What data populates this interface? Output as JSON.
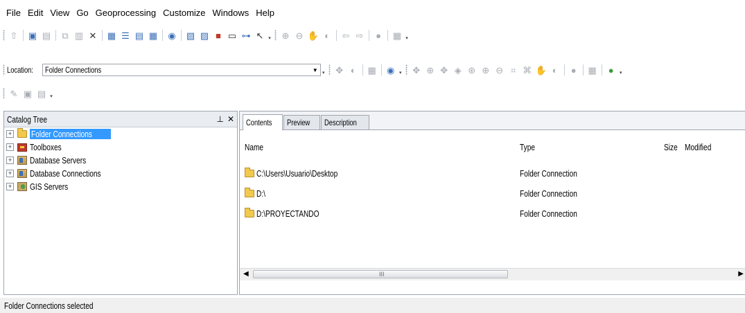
{
  "menu": [
    "File",
    "Edit",
    "View",
    "Go",
    "Geoprocessing",
    "Customize",
    "Windows",
    "Help"
  ],
  "location": {
    "label": "Location:",
    "value": "Folder Connections"
  },
  "catalog_tree": {
    "title": "Catalog Tree",
    "pin_icon": "pin-icon",
    "close_icon": "close-icon",
    "items": [
      {
        "label": "Folder Connections",
        "icon": "folder-connections-icon",
        "selected": true
      },
      {
        "label": "Toolboxes",
        "icon": "toolbox-icon",
        "selected": false
      },
      {
        "label": "Database Servers",
        "icon": "database-server-icon",
        "selected": false
      },
      {
        "label": "Database Connections",
        "icon": "database-connection-icon",
        "selected": false
      },
      {
        "label": "GIS Servers",
        "icon": "gis-server-icon",
        "selected": false
      }
    ]
  },
  "contents": {
    "tabs": [
      "Contents",
      "Preview",
      "Description"
    ],
    "active_tab": "Contents",
    "columns": {
      "name": "Name",
      "type": "Type",
      "size": "Size",
      "modified": "Modified"
    },
    "rows": [
      {
        "name": "C:\\Users\\Usuario\\Desktop",
        "type": "Folder Connection"
      },
      {
        "name": "D:\\",
        "type": "Folder Connection"
      },
      {
        "name": "D:\\PROYECTANDO",
        "type": "Folder Connection"
      }
    ],
    "scroll_grip": "III"
  },
  "status": "Folder Connections selected",
  "colors": {
    "selection": "#3399ff",
    "pane_header": "#e9edf2",
    "folder": "#f2c94c"
  }
}
